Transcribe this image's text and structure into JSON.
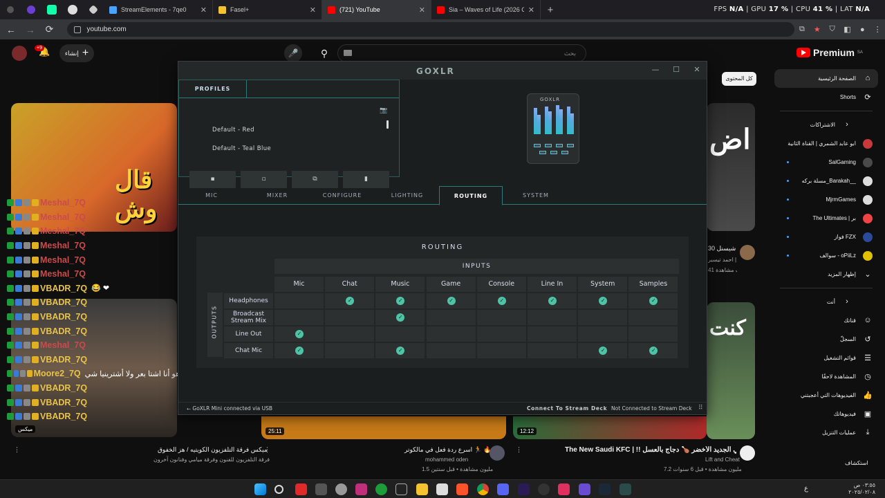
{
  "browser": {
    "tabs": [
      {
        "title": "StreamElements - 7qe0",
        "favicon": "#4aa3ff"
      },
      {
        "title": "Fasel+",
        "favicon": "#f4c430"
      },
      {
        "title": "(721) YouTube",
        "favicon": "#ff0000"
      },
      {
        "title": "Sia – Waves of Life (2026 Official Vi...",
        "favicon": "#ff0000"
      }
    ],
    "active_tab": 2,
    "url": "youtube.com",
    "stats": {
      "fps_label": "FPS",
      "fps": "N/A",
      "gpu_label": "GPU",
      "gpu": "17 %",
      "cpu_label": "CPU",
      "cpu": "41 %",
      "lat_label": "LAT",
      "lat": "N/A"
    }
  },
  "youtube": {
    "notif_count": "+9",
    "create_label": "إنشاء",
    "search_placeholder": "بحث",
    "logo": "Premium",
    "logo_region": "SA",
    "chip": "كل المحتوى",
    "sidebar": {
      "main": [
        {
          "label": "الصفحة الرئيسية",
          "icon": "home-icon"
        },
        {
          "label": "Shorts",
          "icon": "shorts-icon"
        }
      ],
      "subs_title": "الاشتراكات",
      "subs": [
        {
          "label": "ابو عابد الشمري | القناة الثانية",
          "color": "#c83a3a"
        },
        {
          "label": "SalGaming",
          "color": "#4a4a4a"
        },
        {
          "label": "مسلة بركه_Barakah__",
          "color": "#ddd"
        },
        {
          "label": "MjrmGames",
          "color": "#ddd"
        },
        {
          "label": "The Ultimates | بر",
          "color": "#e44"
        },
        {
          "label": "فواز FZX",
          "color": "#2a4a9a"
        },
        {
          "label": "سوالف - oPiiLz",
          "color": "#e0c000"
        }
      ],
      "show_more": "إظهار المزيد",
      "you_title": "أنت",
      "you": [
        {
          "label": "قناتك",
          "icon": "person-icon"
        },
        {
          "label": "السجلّ",
          "icon": "history-icon"
        },
        {
          "label": "قوائم التشغيل",
          "icon": "playlist-icon"
        },
        {
          "label": "المشاهدة لاحقًا",
          "icon": "clock-icon"
        },
        {
          "label": "الفيديوهات التي أعجبتني",
          "icon": "like-icon"
        },
        {
          "label": "فيديوهاتك",
          "icon": "video-icon"
        },
        {
          "label": "عمليات التنزيل",
          "icon": "download-icon"
        }
      ],
      "explore": "استكشاف"
    },
    "videos": [
      {
        "title": "ميكس فرقة التلفزيون الكويتيه / هز الخفوق",
        "meta": "فرقة التلفزيون للفنون وفرقة ميامي وفنانون آخرون",
        "duration": "ميكس"
      },
      {
        "title": "اسرع ردة فعل في مالكوتر 🏃 🔥",
        "channel": "mohammed oden",
        "meta": "1.5 مليون مشاهدة • قبل سنتين",
        "duration": "25:11"
      },
      {
        "title": "The New Saudi KFC | !! كنتاكي الجديد الأخضر 🍗 دجاج بالعسل",
        "channel": "Lift and Cheat",
        "meta": "7.2 مليون مشاهدة • قبل 6 سنوات",
        "duration": "12:12"
      },
      {
        "title": "شيسنل 30",
        "channel": "احمد تيسير | Ahmad",
        "meta": "41 ألف مشاهدة"
      }
    ],
    "thumb_text": [
      "اض",
      "قال وش",
      "كنت"
    ]
  },
  "chat": {
    "lines": [
      {
        "user": "Meshal_7Q",
        "color": "#c94b4b",
        "msg": ""
      },
      {
        "user": "Meshal_7Q",
        "color": "#c94b4b",
        "msg": ""
      },
      {
        "user": "Meshal_7Q",
        "color": "#c94b4b",
        "msg": ""
      },
      {
        "user": "Meshal_7Q",
        "color": "#c94b4b",
        "msg": ""
      },
      {
        "user": "Meshal_7Q",
        "color": "#c94b4b",
        "msg": ""
      },
      {
        "user": "Meshal_7Q",
        "color": "#c94b4b",
        "msg": ""
      },
      {
        "user": "VBADR_7Q",
        "color": "#e8c34a",
        "msg": "😂 ❤ "
      },
      {
        "user": "VBADR_7Q",
        "color": "#e8c34a",
        "msg": ""
      },
      {
        "user": "VBADR_7Q",
        "color": "#e8c34a",
        "msg": ""
      },
      {
        "user": "VBADR_7Q",
        "color": "#e8c34a",
        "msg": ""
      },
      {
        "user": "Meshal_7Q",
        "color": "#c94b4b",
        "msg": ""
      },
      {
        "user": "VBADR_7Q",
        "color": "#e8c34a",
        "msg": ""
      },
      {
        "user": "Moore2_7Q",
        "color": "#e8c34a",
        "msg": "هو أنا اشتا بعر ولا أشترينيا شي"
      },
      {
        "user": "VBADR_7Q",
        "color": "#e8c34a",
        "msg": ""
      },
      {
        "user": "VBADR_7Q",
        "color": "#e8c34a",
        "msg": ""
      },
      {
        "user": "VBADR_7Q",
        "color": "#e8c34a",
        "msg": ""
      }
    ]
  },
  "goxlr": {
    "title": "GOXLR",
    "profiles_tab": "PROFILES",
    "profiles": [
      "Default - Red",
      "Default - Teal Blue"
    ],
    "profile_buttons": [
      "save-icon",
      "new-icon",
      "copy-icon",
      "delete-icon"
    ],
    "device_label": "GOXLR",
    "tabs": [
      "MIC",
      "MIXER",
      "CONFIGURE",
      "LIGHTING",
      "ROUTING",
      "SYSTEM"
    ],
    "active_tab": "ROUTING",
    "routing": {
      "title": "ROUTING",
      "inputs_label": "INPUTS",
      "outputs_label": "OUTPUTS",
      "inputs": [
        "Mic",
        "Chat",
        "Music",
        "Game",
        "Console",
        "Line In",
        "System",
        "Samples"
      ],
      "outputs": [
        "Headphones",
        "Broadcast Stream Mix",
        "Line Out",
        "Chat Mic"
      ],
      "matrix": [
        [
          false,
          true,
          true,
          true,
          true,
          true,
          true,
          true
        ],
        [
          false,
          false,
          true,
          false,
          false,
          false,
          false,
          false
        ],
        [
          true,
          false,
          false,
          false,
          false,
          false,
          false,
          false
        ],
        [
          true,
          false,
          true,
          false,
          false,
          false,
          true,
          true
        ]
      ]
    },
    "status": {
      "usb": "GoXLR Mini connected via USB",
      "connect": "Connect To Stream Deck",
      "deck": "Not Connected to Stream Deck"
    }
  },
  "taskbar": {
    "time": "٠٣:٥٥ ص",
    "date": "٢٠٢٥/٠٢/٠٨",
    "lang": "ع"
  }
}
